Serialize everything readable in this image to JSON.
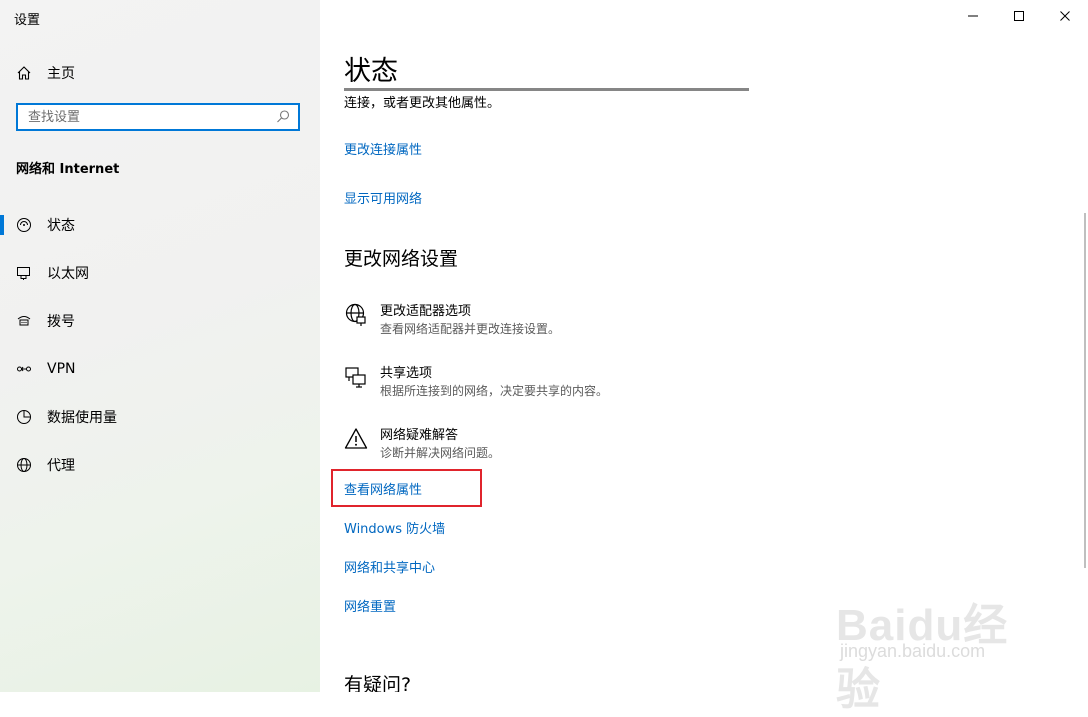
{
  "window": {
    "title": "设置"
  },
  "sidebar": {
    "home_label": "主页",
    "search_placeholder": "查找设置",
    "section": "网络和 Internet",
    "items": [
      {
        "label": "状态",
        "icon": "home-status-icon",
        "active": true
      },
      {
        "label": "以太网",
        "icon": "ethernet-icon"
      },
      {
        "label": "拨号",
        "icon": "dialup-icon"
      },
      {
        "label": "VPN",
        "icon": "vpn-icon"
      },
      {
        "label": "数据使用量",
        "icon": "data-usage-icon"
      },
      {
        "label": "代理",
        "icon": "globe-icon"
      }
    ]
  },
  "main": {
    "title": "状态",
    "cut_text_line": "连接，或者更改其他属性。",
    "links_top": [
      "更改连接属性",
      "显示可用网络"
    ],
    "change_heading": "更改网络设置",
    "options": [
      {
        "title": "更改适配器选项",
        "desc": "查看网络适配器并更改连接设置。",
        "icon": "adapter-globe-icon"
      },
      {
        "title": "共享选项",
        "desc": "根据所连接到的网络，决定要共享的内容。",
        "icon": "sharing-icon"
      },
      {
        "title": "网络疑难解答",
        "desc": "诊断并解决网络问题。",
        "icon": "warning-icon"
      }
    ],
    "links_bottom": [
      "查看网络属性",
      "Windows 防火墙",
      "网络和共享中心",
      "网络重置"
    ],
    "question_heading": "有疑问?"
  },
  "watermark": {
    "logo": "Baidu经验",
    "url": "jingyan.baidu.com"
  },
  "colors": {
    "accent": "#0078d7",
    "link": "#0067c0",
    "highlight": "#e0242c"
  }
}
